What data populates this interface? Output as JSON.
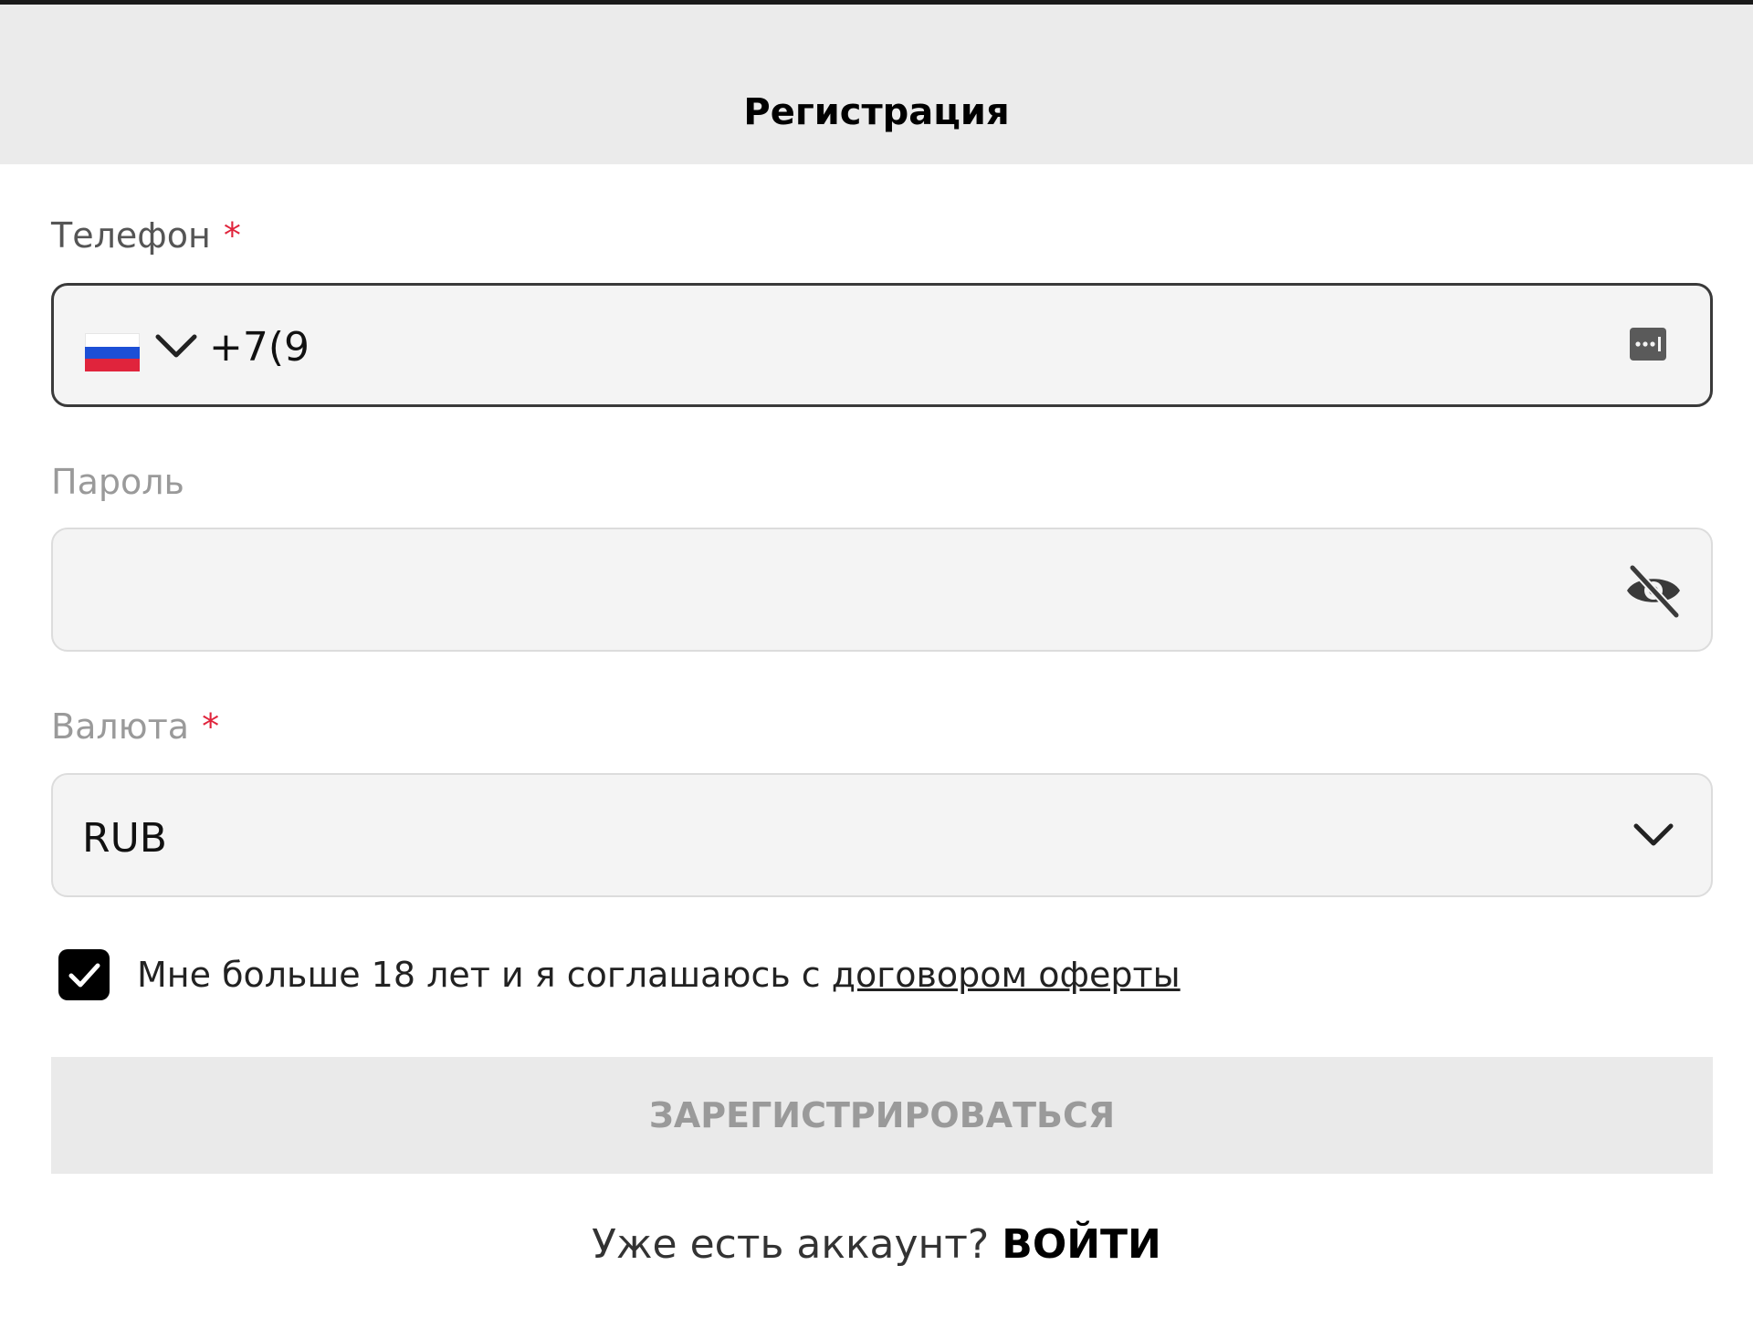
{
  "header": {
    "title": "Регистрация"
  },
  "phone": {
    "label": "Телефон",
    "required_mark": "*",
    "country": "Russia",
    "value": "+7(9"
  },
  "password": {
    "label": "Пароль",
    "value": ""
  },
  "currency": {
    "label": "Валюта",
    "required_mark": "*",
    "selected": "RUB"
  },
  "consent": {
    "checked": true,
    "text": "Мне больше 18 лет и я соглашаюсь с ",
    "link_text": "договором оферты"
  },
  "submit": {
    "label": "ЗАРЕГИСТРИРОВАТЬСЯ"
  },
  "footer": {
    "text": "Уже есть аккаунт? ",
    "link_text": "ВОЙТИ"
  },
  "colors": {
    "required": "#e0243c",
    "field_bg": "#f4f4f4",
    "disabled_button_bg": "#eaeaea"
  }
}
